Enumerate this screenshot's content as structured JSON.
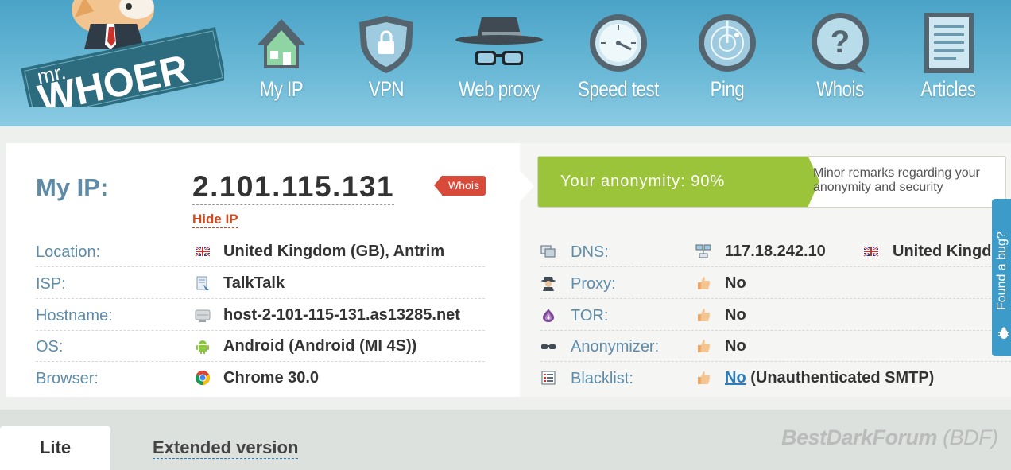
{
  "header": {
    "logo": {
      "top_text": "mr.",
      "main_text": "WHOER"
    },
    "nav": [
      {
        "label": "My IP",
        "icon": "house-icon"
      },
      {
        "label": "VPN",
        "icon": "shield-lock-icon"
      },
      {
        "label": "Web proxy",
        "icon": "spy-hat-glasses-icon"
      },
      {
        "label": "Speed test",
        "icon": "speedometer-icon"
      },
      {
        "label": "Ping",
        "icon": "radar-icon"
      },
      {
        "label": "Whois",
        "icon": "question-bubble-icon"
      },
      {
        "label": "Articles",
        "icon": "document-icon"
      }
    ]
  },
  "ip": {
    "label": "My IP:",
    "value": "2.101.115.131",
    "hide_link": "Hide IP",
    "whois_badge": "Whois"
  },
  "left_info": [
    {
      "label": "Location:",
      "icon": "uk-flag-icon",
      "value": "United Kingdom (GB), Antrim"
    },
    {
      "label": "ISP:",
      "icon": "isp-icon",
      "value": "TalkTalk"
    },
    {
      "label": "Hostname:",
      "icon": "server-icon",
      "value": "host-2-101-115-131.as13285.net"
    },
    {
      "label": "OS:",
      "icon": "android-icon",
      "value": "Android (Android (MI 4S))"
    },
    {
      "label": "Browser:",
      "icon": "chrome-icon",
      "value": "Chrome 30.0"
    }
  ],
  "anonymity": {
    "text": "Your anonymity: 90%",
    "value_percent": 90,
    "note": "Minor remarks regarding your anonymity and security"
  },
  "right_info": {
    "dns": {
      "label": "DNS:",
      "icon": "dns-icon",
      "server_icon": "network-icon",
      "ip": "117.18.242.10",
      "flag_icon": "uk-flag-icon",
      "country": "United Kingdo"
    },
    "rows": [
      {
        "label": "Proxy:",
        "icon": "spy-icon",
        "status_icon": "thumbs-up-icon",
        "value": "No"
      },
      {
        "label": "TOR:",
        "icon": "onion-icon",
        "status_icon": "thumbs-up-icon",
        "value": "No"
      },
      {
        "label": "Anonymizer:",
        "icon": "glasses-icon",
        "status_icon": "thumbs-up-icon",
        "value": "No"
      }
    ],
    "blacklist": {
      "label": "Blacklist:",
      "icon": "list-icon",
      "status_icon": "thumbs-up-icon",
      "value": "No",
      "suffix": " (Unauthenticated SMTP)"
    }
  },
  "bug_tab": {
    "text": "Found a bug?",
    "icon": "bug-icon"
  },
  "tabs": {
    "lite": "Lite",
    "extended": "Extended version"
  },
  "watermark": {
    "main": "BestDarkForum",
    "abbr": "(BDF)"
  },
  "colors": {
    "header_blue": "#5aaed0",
    "label_blue": "#5e8ba8",
    "anon_green": "#9cc43a",
    "hide_ip_red": "#d2491e",
    "whois_red": "#d84a3a",
    "link_blue": "#2a7cc0"
  }
}
